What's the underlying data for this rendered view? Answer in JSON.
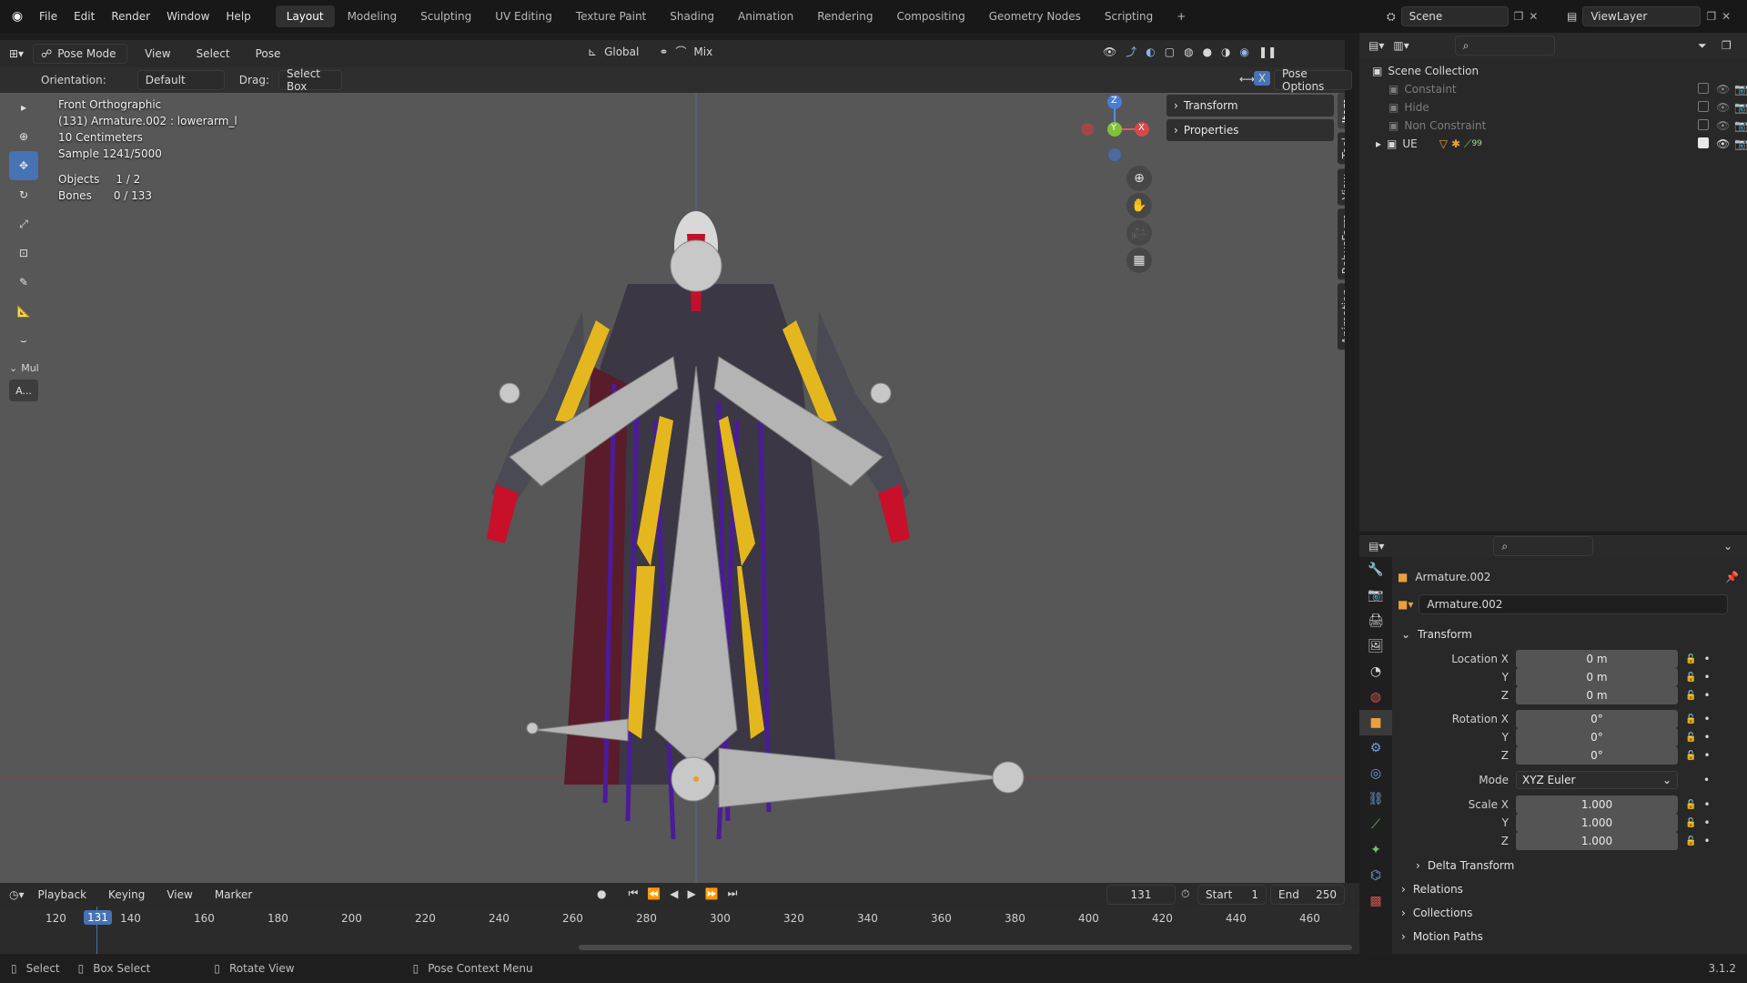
{
  "menu": [
    "File",
    "Edit",
    "Render",
    "Window",
    "Help"
  ],
  "workspaces": [
    {
      "label": "Layout",
      "active": true
    },
    {
      "label": "Modeling"
    },
    {
      "label": "Sculpting"
    },
    {
      "label": "UV Editing"
    },
    {
      "label": "Texture Paint"
    },
    {
      "label": "Shading"
    },
    {
      "label": "Animation"
    },
    {
      "label": "Rendering"
    },
    {
      "label": "Compositing"
    },
    {
      "label": "Geometry Nodes"
    },
    {
      "label": "Scripting"
    }
  ],
  "add_workspace": "+",
  "scene": {
    "label": "Scene",
    "viewlayer": "ViewLayer"
  },
  "viewport_header": {
    "mode": "Pose Mode",
    "menus": [
      "View",
      "Select",
      "Pose"
    ],
    "transform_space": "Global",
    "proportional": "Mix"
  },
  "tool_header": {
    "orientation_label": "Orientation:",
    "orientation_value": "Default",
    "drag_label": "Drag:",
    "drag_value": "Select Box",
    "pose_options": "Pose Options",
    "x_mirror": "X"
  },
  "overlay": {
    "view_name": "Front Orthographic",
    "active": "(131) Armature.002 : lowerarm_l",
    "scale": "10 Centimeters",
    "sample": "Sample 1241/5000",
    "objects_label": "Objects",
    "objects_value": "1 / 2",
    "bones_label": "Bones",
    "bones_value": "0 / 133"
  },
  "toolbar": {
    "items": [
      "select-box-tool",
      "cursor-tool",
      "move-tool",
      "rotate-tool",
      "scale-tool",
      "transform-tool",
      "annotate-tool",
      "measure-tool",
      "relax-tool"
    ],
    "active_index": 2,
    "group_label": "Mul",
    "group_button": "A..."
  },
  "gizmo": {
    "x": "X",
    "y": "Y",
    "z": "Z"
  },
  "npanel": {
    "rows": [
      "Transform",
      "Properties"
    ],
    "tabs": [
      "Item",
      "Tool",
      "View",
      "RebusFarm",
      "Animation"
    ]
  },
  "outliner": {
    "root": "Scene Collection",
    "items": [
      {
        "label": "Constaint",
        "checked": false
      },
      {
        "label": "Hide",
        "checked": false
      },
      {
        "label": "Non Constraint",
        "checked": false
      },
      {
        "label": "UE",
        "checked": true,
        "badge": "99"
      }
    ]
  },
  "properties": {
    "header_object": "Armature.002",
    "object_name": "Armature.002",
    "transform_title": "Transform",
    "location": {
      "label": "Location X",
      "x": "0 m",
      "y": "0 m",
      "z": "0 m"
    },
    "rotation": {
      "label": "Rotation X",
      "x": "0°",
      "y": "0°",
      "z": "0°"
    },
    "mode_label": "Mode",
    "mode_value": "XYZ Euler",
    "scale": {
      "label": "Scale X",
      "x": "1.000",
      "y": "1.000",
      "z": "1.000"
    },
    "axis_y": "Y",
    "axis_z": "Z",
    "sections": [
      "Delta Transform",
      "Relations",
      "Collections",
      "Motion Paths"
    ]
  },
  "timeline": {
    "menus": [
      "Playback",
      "Keying",
      "View",
      "Marker"
    ],
    "current_frame": "131",
    "start_label": "Start",
    "start_value": "1",
    "end_label": "End",
    "end_value": "250",
    "ticks": [
      "120",
      "140",
      "160",
      "180",
      "200",
      "220",
      "240",
      "260",
      "280",
      "300",
      "320",
      "340",
      "360",
      "380",
      "400",
      "420",
      "440",
      "460"
    ],
    "playhead": "131"
  },
  "status": {
    "items": [
      "Select",
      "Box Select",
      "Rotate View",
      "Pose Context Menu"
    ],
    "version": "3.1.2"
  },
  "colors": {
    "accent": "#4772b3",
    "bone_yellow": "#e5b71f",
    "bone_gray": "#b4b4b4"
  }
}
